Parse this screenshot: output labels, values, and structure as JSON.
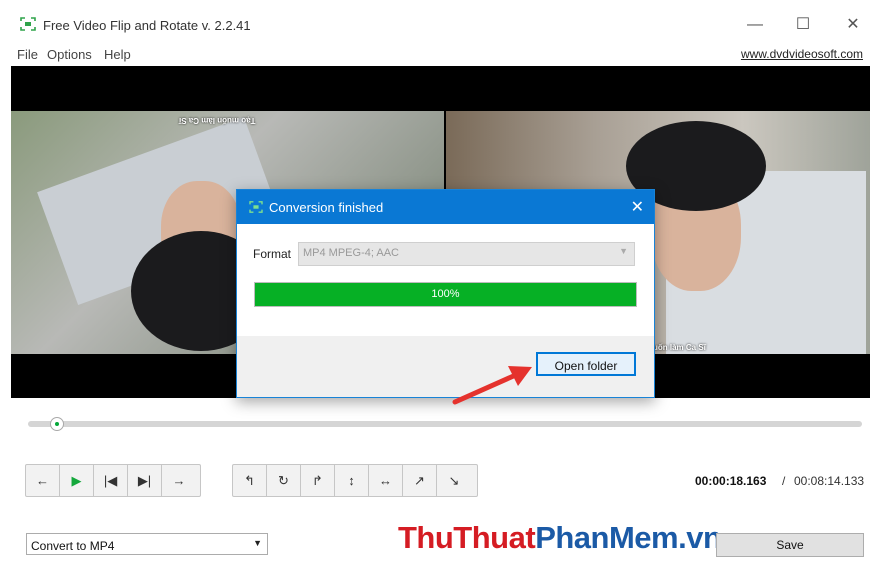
{
  "window": {
    "title": "Free Video Flip and Rotate v. 2.2.41",
    "controls": {
      "minimize": "—",
      "maximize": "☐",
      "close": "✕"
    }
  },
  "menu": {
    "items": [
      "File",
      "Options",
      "Help"
    ],
    "site_link": "www.dvdvideosoft.com"
  },
  "video": {
    "subtitle_left": "Tạo muốn làm Ca Sĩ",
    "subtitle_right": "uốn làm Ca Sĩ"
  },
  "dialog": {
    "title": "Conversion finished",
    "close": "✕",
    "format_label": "Format",
    "format_value": "MP4 MPEG-4; AAC",
    "progress_percent": 100,
    "progress_text": "100%",
    "open_folder": "Open folder"
  },
  "player": {
    "seek_position": 0.03
  },
  "controls": {
    "left_group": [
      {
        "name": "prev-frame-icon",
        "glyph": "←"
      },
      {
        "name": "play-icon",
        "glyph": "▶"
      },
      {
        "name": "skip-start-icon",
        "glyph": "|◀"
      },
      {
        "name": "skip-end-icon",
        "glyph": "▶|"
      },
      {
        "name": "next-frame-icon",
        "glyph": "→"
      }
    ],
    "right_group": [
      {
        "name": "rotate-left-icon",
        "glyph": "↰"
      },
      {
        "name": "rotate-180-icon",
        "glyph": "↻"
      },
      {
        "name": "rotate-right-icon",
        "glyph": "↱"
      },
      {
        "name": "flip-vertical-icon",
        "glyph": "↕"
      },
      {
        "name": "flip-horizontal-icon",
        "glyph": "↔"
      },
      {
        "name": "transpose-icon",
        "glyph": "↗"
      },
      {
        "name": "transverse-icon",
        "glyph": "↘"
      }
    ]
  },
  "time": {
    "current": "00:00:18.163",
    "separator": "/",
    "total": "00:08:14.133"
  },
  "bottom": {
    "convert_value": "Convert to MP4",
    "watermark_part1": "ThuThuat",
    "watermark_part2": "PhanMem",
    "watermark_part3": ".vn",
    "save_label": "Save"
  },
  "colors": {
    "accent": "#0a78d4",
    "progress": "#06b025",
    "arrow": "#e5322d"
  }
}
